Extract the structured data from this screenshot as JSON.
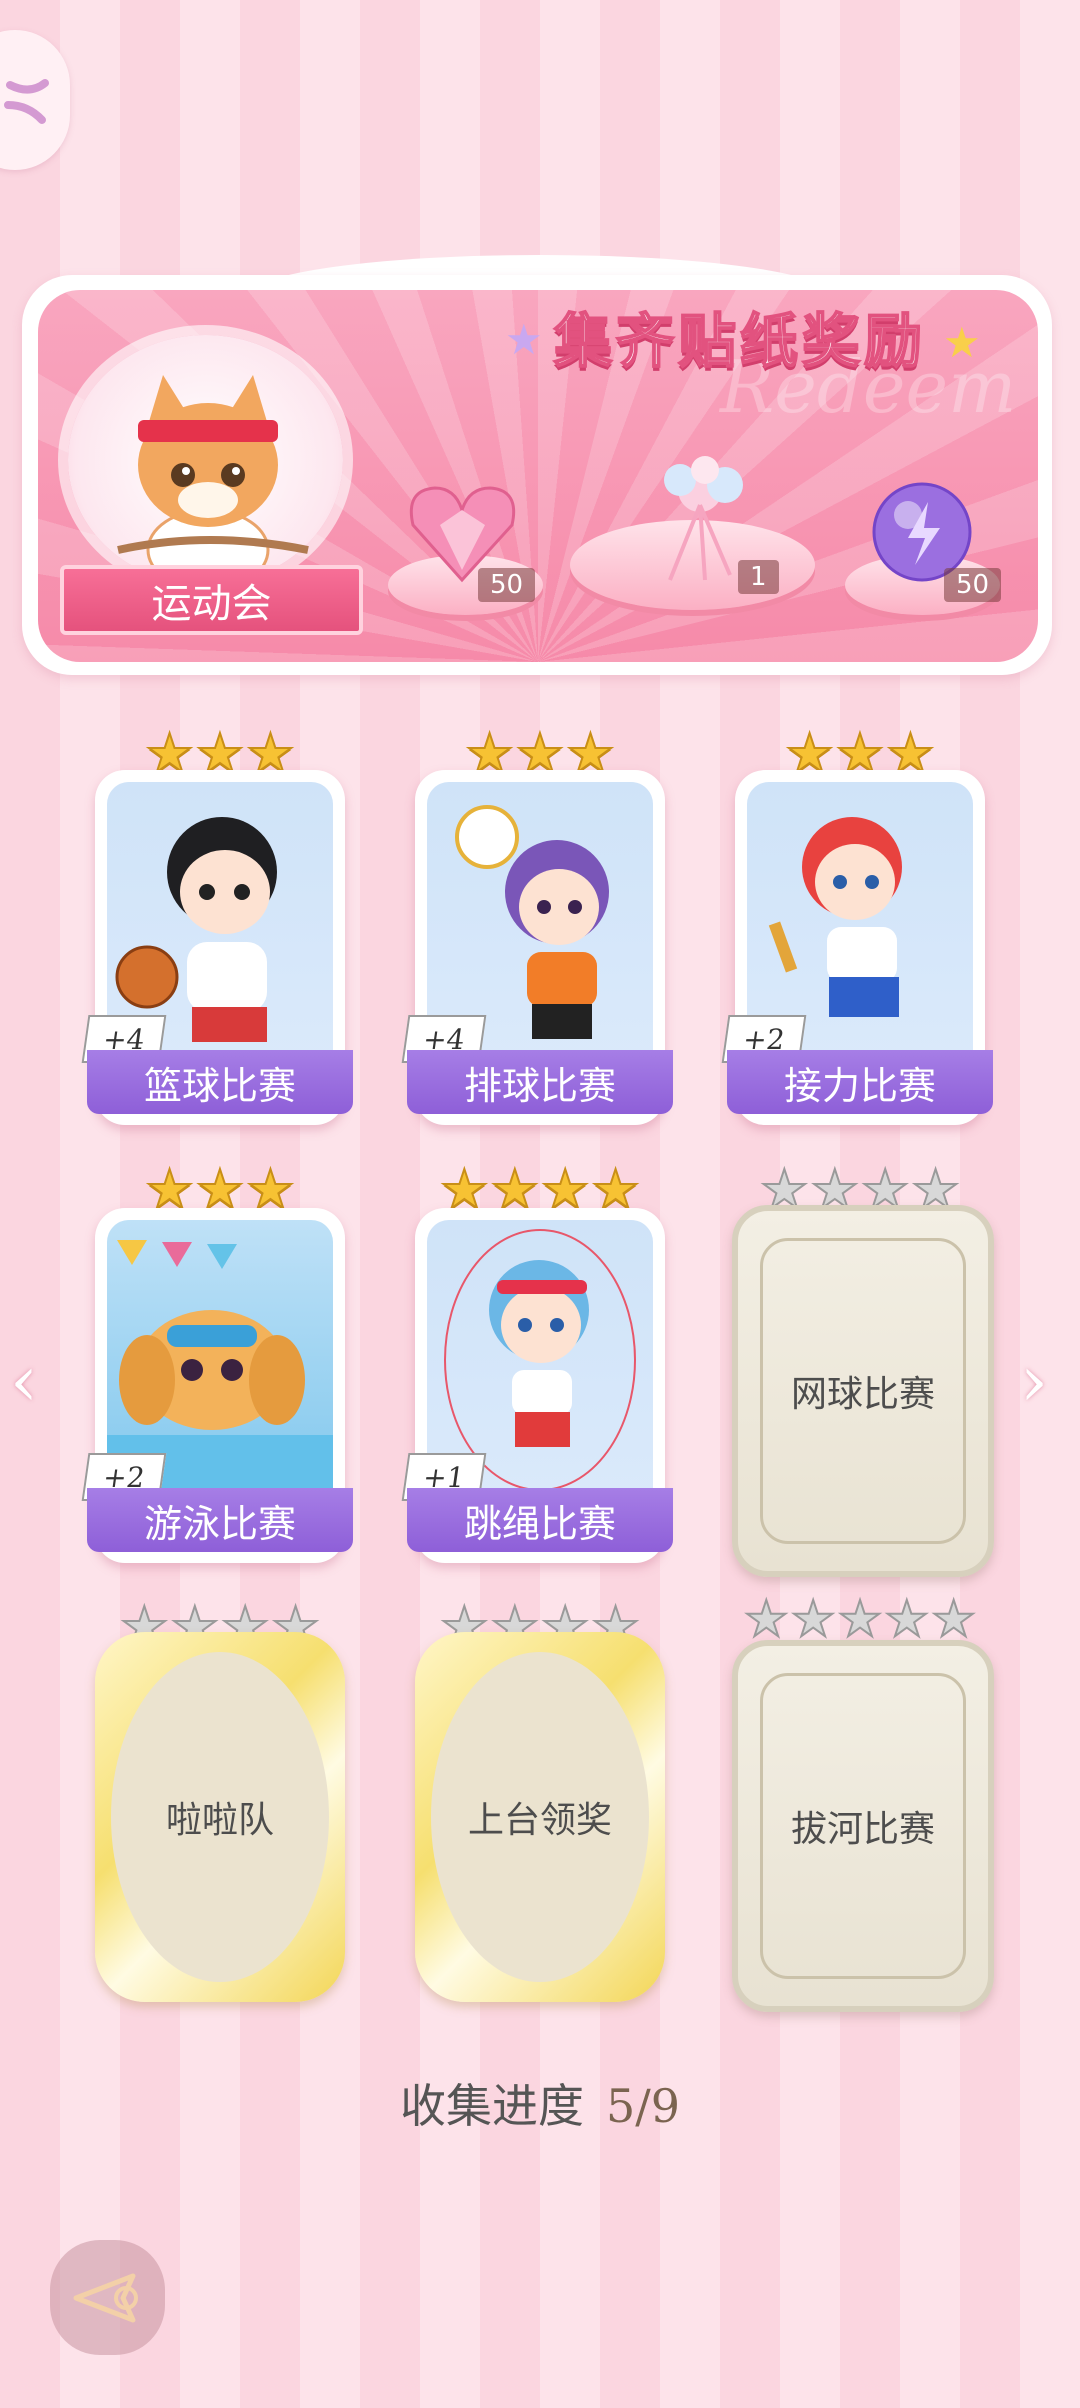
{
  "banner": {
    "title": "集齐贴纸奖励",
    "watermark": "Redeem",
    "event_name": "运动会",
    "rewards": [
      {
        "icon": "pink-heart-gem-icon",
        "quantity": "50"
      },
      {
        "icon": "flower-bouquet-icon",
        "quantity": "1"
      },
      {
        "icon": "purple-lightning-orb-icon",
        "quantity": "50"
      }
    ]
  },
  "stickers": [
    {
      "label": "篮球比赛",
      "bonus": "+4",
      "stars": 3,
      "max_stars": 3,
      "unlocked": true
    },
    {
      "label": "排球比赛",
      "bonus": "+4",
      "stars": 3,
      "max_stars": 3,
      "unlocked": true
    },
    {
      "label": "接力比赛",
      "bonus": "+2",
      "stars": 3,
      "max_stars": 3,
      "unlocked": true
    },
    {
      "label": "游泳比赛",
      "bonus": "+2",
      "stars": 3,
      "max_stars": 3,
      "unlocked": true
    },
    {
      "label": "跳绳比赛",
      "bonus": "+1",
      "stars": 4,
      "max_stars": 4,
      "unlocked": true
    },
    {
      "label": "网球比赛",
      "stars": 0,
      "max_stars": 4,
      "unlocked": false
    },
    {
      "label": "啦啦队",
      "stars": 0,
      "max_stars": 4,
      "unlocked": false
    },
    {
      "label": "上台领奖",
      "stars": 0,
      "max_stars": 4,
      "unlocked": false
    },
    {
      "label": "拔河比赛",
      "stars": 0,
      "max_stars": 5,
      "unlocked": false
    }
  ],
  "progress": {
    "label": "收集进度",
    "value": "5/9"
  },
  "colors": {
    "accent_pink": "#f68aa9",
    "label_purple": "#8e5fd8",
    "star_gold": "#f7c233"
  }
}
